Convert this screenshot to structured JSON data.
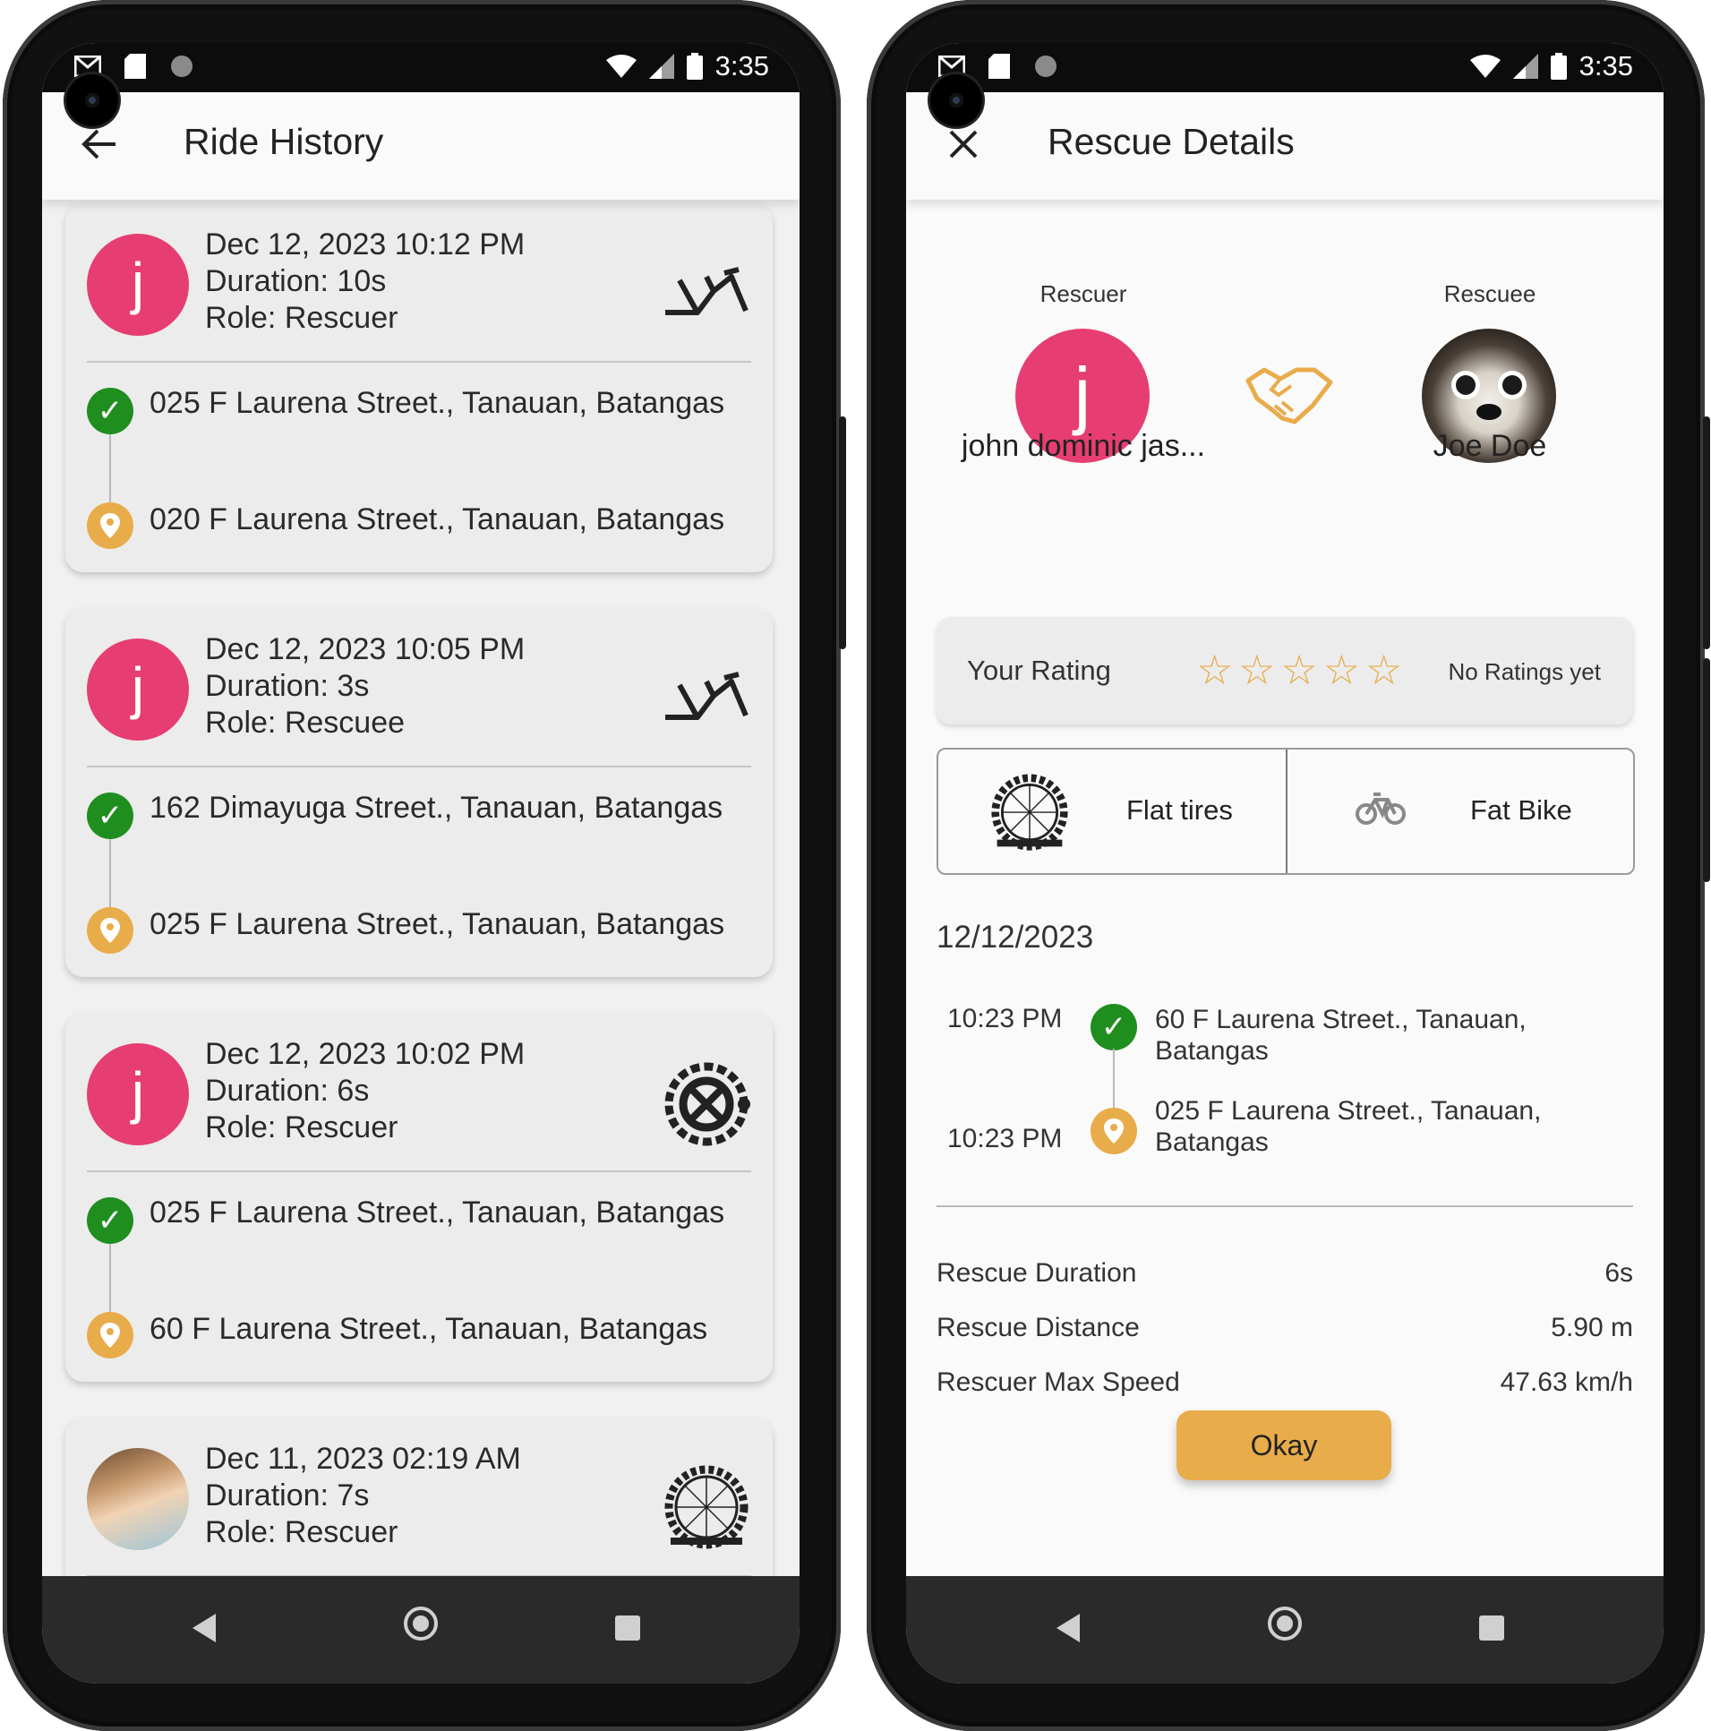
{
  "left_screen": {
    "status": {
      "time": "3:35"
    },
    "appbar": {
      "title": "Ride History",
      "nav_icon": "arrow-back-icon"
    },
    "rides": [
      {
        "date": "Dec 12, 2023 10:12 PM",
        "duration": "Duration: 10s",
        "role": "Role: Rescuer",
        "avatar_letter": "j",
        "ride_icon": "broken-frame-icon",
        "from": "025 F Laurena Street., Tanauan, Batangas",
        "to": "020 F Laurena Street., Tanauan, Batangas"
      },
      {
        "date": "Dec 12, 2023 10:05 PM",
        "duration": "Duration: 3s",
        "role": "Role: Rescuee",
        "avatar_letter": "j",
        "ride_icon": "broken-frame-icon",
        "from": "162 Dimayuga Street., Tanauan, Batangas",
        "to": "025 F Laurena Street., Tanauan, Batangas"
      },
      {
        "date": "Dec 12, 2023 10:02 PM",
        "duration": "Duration: 6s",
        "role": "Role: Rescuer",
        "avatar_letter": "j",
        "ride_icon": "chain-gear-icon",
        "from": "025 F Laurena Street., Tanauan, Batangas",
        "to": "60 F Laurena Street., Tanauan, Batangas"
      },
      {
        "date": "Dec 11, 2023 02:19 AM",
        "duration": "Duration: 7s",
        "role": "Role: Rescuer",
        "avatar_letter": "",
        "ride_icon": "flat-tire-icon",
        "from": "",
        "to": ""
      }
    ]
  },
  "right_screen": {
    "status": {
      "time": "3:35"
    },
    "appbar": {
      "title": "Rescue Details",
      "nav_icon": "close-icon"
    },
    "rescuer": {
      "label": "Rescuer",
      "name": "john dominic jas...",
      "avatar_letter": "j"
    },
    "rescuee": {
      "label": "Rescuee",
      "name": "Joe Doe"
    },
    "rating": {
      "label": "Your Rating",
      "stars": 0,
      "max_stars": 5,
      "status": "No Ratings yet"
    },
    "issue": {
      "problem": "Flat tires",
      "bike": "Fat Bike"
    },
    "date": "12/12/2023",
    "timeline": [
      {
        "time": "10:23 PM",
        "address": "60 F Laurena Street., Tanauan, Batangas"
      },
      {
        "time": "10:23 PM",
        "address": "025 F Laurena Street., Tanauan, Batangas"
      }
    ],
    "stats": [
      {
        "label": "Rescue Duration",
        "value": "6s"
      },
      {
        "label": "Rescue Distance",
        "value": "5.90 m"
      },
      {
        "label": "Rescuer Max Speed",
        "value": "47.63 km/h"
      }
    ],
    "button": "Okay"
  },
  "colors": {
    "avatar": "#e63d72",
    "accent": "#e9ac4a",
    "check": "#1f8e1f"
  }
}
